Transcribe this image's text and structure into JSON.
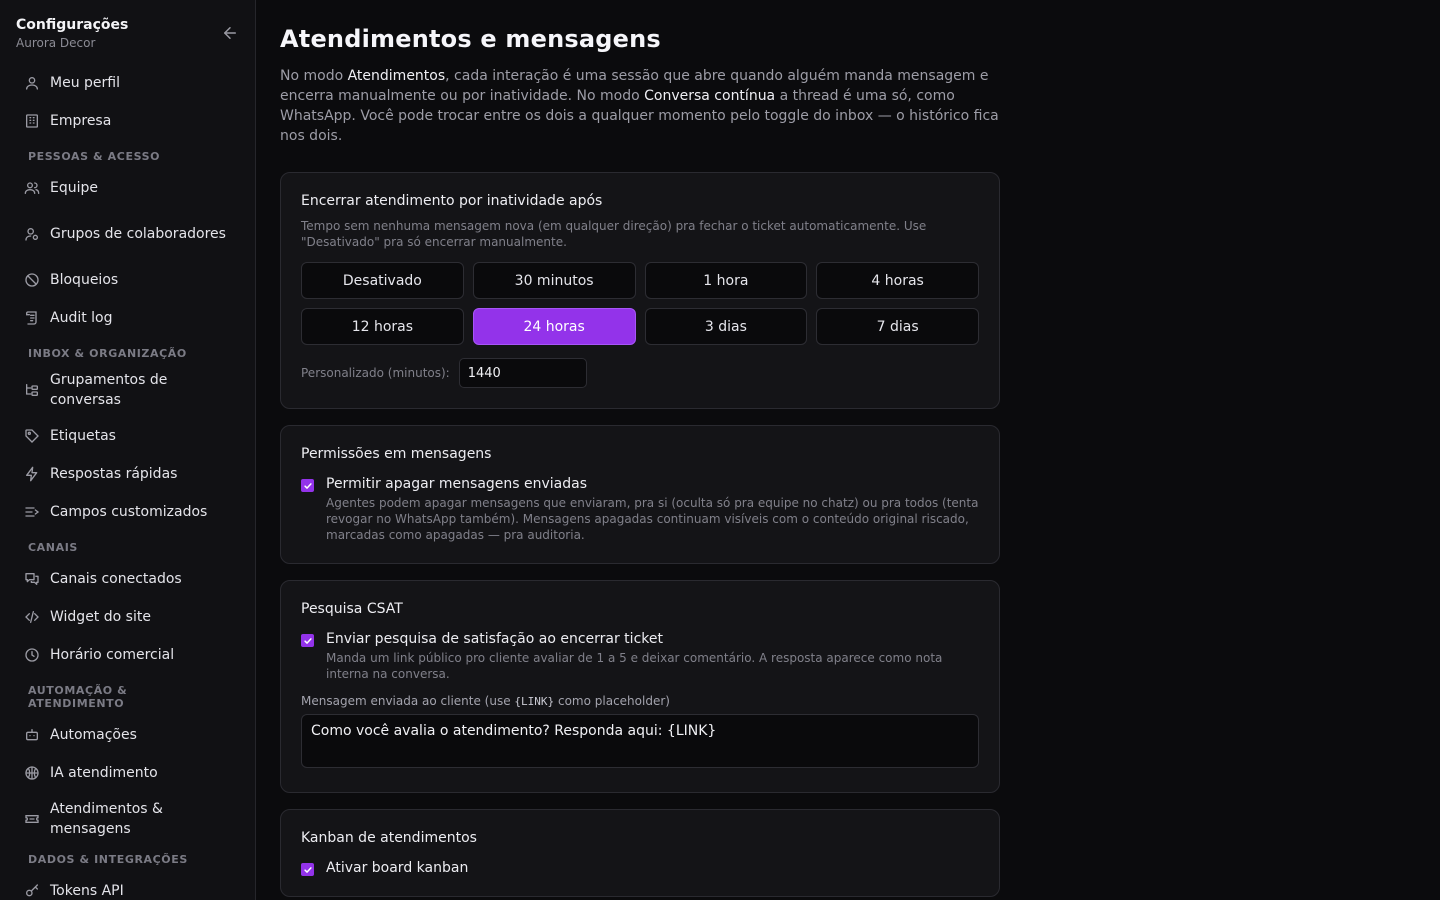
{
  "sidebar": {
    "title": "Configurações",
    "subtitle": "Aurora Decor",
    "items_top": [
      {
        "label": "Meu perfil",
        "icon": "user-icon"
      },
      {
        "label": "Empresa",
        "icon": "building-icon"
      }
    ],
    "sections": [
      {
        "title": "Pessoas & acesso",
        "items": [
          {
            "label": "Equipe",
            "icon": "users-icon"
          },
          {
            "label": "Grupos de colaboradores",
            "icon": "user-group-icon"
          },
          {
            "label": "Bloqueios",
            "icon": "ban-icon"
          },
          {
            "label": "Audit log",
            "icon": "scroll-icon"
          }
        ]
      },
      {
        "title": "Inbox & organização",
        "items": [
          {
            "label": "Grupamentos de conversas",
            "icon": "folder-tree-icon"
          },
          {
            "label": "Etiquetas",
            "icon": "tag-icon"
          },
          {
            "label": "Respostas rápidas",
            "icon": "zap-icon"
          },
          {
            "label": "Campos customizados",
            "icon": "form-list-icon"
          }
        ]
      },
      {
        "title": "Canais",
        "items": [
          {
            "label": "Canais conectados",
            "icon": "chat-bubbles-icon"
          },
          {
            "label": "Widget do site",
            "icon": "code-icon"
          },
          {
            "label": "Horário comercial",
            "icon": "clock-icon"
          }
        ]
      },
      {
        "title": "Automação & atendimento",
        "items": [
          {
            "label": "Automações",
            "icon": "bot-icon"
          },
          {
            "label": "IA atendimento",
            "icon": "brain-icon"
          },
          {
            "label": "Atendimentos & mensagens",
            "icon": "ticket-icon"
          }
        ]
      },
      {
        "title": "Dados & integrações",
        "items": [
          {
            "label": "Tokens API",
            "icon": "key-icon"
          }
        ]
      }
    ]
  },
  "main": {
    "title": "Atendimentos e mensagens",
    "intro": {
      "p1": "No modo ",
      "b1": "Atendimentos",
      "p2": ", cada interação é uma sessão que abre quando alguém manda mensagem e encerra manualmente ou por inatividade. No modo ",
      "b2": "Conversa contínua",
      "p3": " a thread é uma só, como WhatsApp. Você pode trocar entre os dois a qualquer momento pelo toggle do inbox — o histórico fica nos dois."
    },
    "inactivity": {
      "title": "Encerrar atendimento por inatividade após",
      "desc": "Tempo sem nenhuma mensagem nova (em qualquer direção) pra fechar o ticket automaticamente. Use \"Desativado\" pra só encerrar manualmente.",
      "options": [
        "Desativado",
        "30 minutos",
        "1 hora",
        "4 horas",
        "12 horas",
        "24 horas",
        "3 dias",
        "7 dias"
      ],
      "selected": "24 horas",
      "custom_label": "Personalizado (minutos):",
      "custom_value": "1440"
    },
    "permissions": {
      "title": "Permissões em mensagens",
      "check_label": "Permitir apagar mensagens enviadas",
      "check_help": "Agentes podem apagar mensagens que enviaram, pra si (oculta só pra equipe no chatz) ou pra todos (tenta revogar no WhatsApp também). Mensagens apagadas continuam visíveis com o conteúdo original riscado, marcadas como apagadas — pra auditoria.",
      "checked": true
    },
    "csat": {
      "title": "Pesquisa CSAT",
      "check_label": "Enviar pesquisa de satisfação ao encerrar ticket",
      "check_help": "Manda um link público pro cliente avaliar de 1 a 5 e deixar comentário. A resposta aparece como nota interna na conversa.",
      "checked": true,
      "message_label_pre": "Mensagem enviada ao cliente (use ",
      "message_label_code": "{LINK}",
      "message_label_post": " como placeholder)",
      "message_value": "Como você avalia o atendimento? Responda aqui: {LINK}"
    },
    "kanban": {
      "title": "Kanban de atendimentos",
      "check_label": "Ativar board kanban",
      "checked": true
    }
  },
  "colors": {
    "accent": "#9333ea",
    "background": "#0b0b0d",
    "card": "#141417"
  }
}
